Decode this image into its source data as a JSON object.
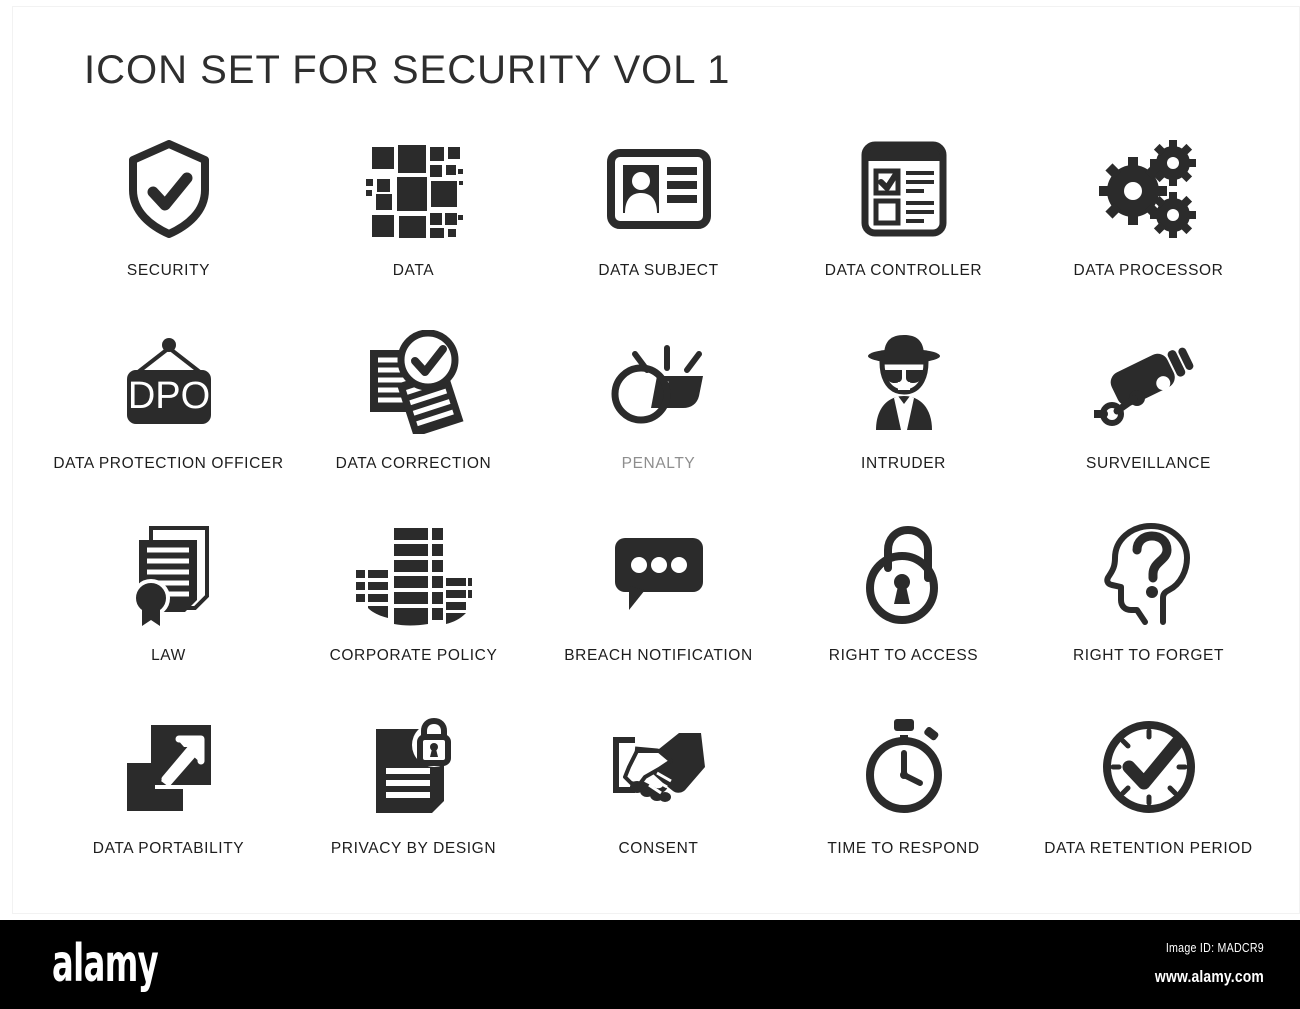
{
  "page": {
    "title": "ICON SET FOR SECURITY VOL 1",
    "background": "#ffffff",
    "icon_color": "#2b2b2b",
    "caption_color": "#1d1d1d"
  },
  "icons": [
    {
      "id": "security",
      "label": "SECURITY",
      "icon": "shield-check-icon",
      "row": 1,
      "col": 1
    },
    {
      "id": "data",
      "label": "DATA",
      "icon": "data-mosaic-squares-icon",
      "row": 1,
      "col": 2
    },
    {
      "id": "data-subject",
      "label": "DATA SUBJECT",
      "icon": "id-card-person-icon",
      "row": 1,
      "col": 3
    },
    {
      "id": "data-controller",
      "label": "DATA CONTROLLER",
      "icon": "checklist-clipboard-icon",
      "row": 1,
      "col": 4
    },
    {
      "id": "data-processor",
      "label": "DATA PROCESSOR",
      "icon": "gears-icon",
      "row": 1,
      "col": 5
    },
    {
      "id": "data-protection-officer",
      "label": "DATA PROTECTION OFFICER",
      "icon": "hanging-sign-dpo-icon",
      "row": 2,
      "col": 1,
      "sign_text": "DPO"
    },
    {
      "id": "data-correction",
      "label": "DATA CORRECTION",
      "icon": "documents-check-icon",
      "row": 2,
      "col": 2
    },
    {
      "id": "penalty",
      "label": "PENALTY",
      "icon": "whistle-icon",
      "row": 2,
      "col": 3,
      "label_faded": true
    },
    {
      "id": "intruder",
      "label": "INTRUDER",
      "icon": "spy-person-hat-icon",
      "row": 2,
      "col": 4
    },
    {
      "id": "surveillance",
      "label": "SURVEILLANCE",
      "icon": "cctv-camera-icon",
      "row": 2,
      "col": 5
    },
    {
      "id": "law",
      "label": "LAW",
      "icon": "certificate-seal-icon",
      "row": 3,
      "col": 1
    },
    {
      "id": "corporate-policy",
      "label": "CORPORATE POLICY",
      "icon": "office-building-icon",
      "row": 3,
      "col": 2
    },
    {
      "id": "breach-notification",
      "label": "BREACH NOTIFICATION",
      "icon": "speech-bubble-dots-icon",
      "row": 3,
      "col": 3
    },
    {
      "id": "right-to-access",
      "label": "RIGHT TO ACCESS",
      "icon": "open-padlock-icon",
      "row": 3,
      "col": 4
    },
    {
      "id": "right-to-forget",
      "label": "RIGHT TO FORGET",
      "icon": "head-question-mark-icon",
      "row": 3,
      "col": 5
    },
    {
      "id": "data-portability",
      "label": "DATA PORTABILITY",
      "icon": "export-arrow-square-icon",
      "row": 4,
      "col": 1
    },
    {
      "id": "privacy-by-design",
      "label": "PRIVACY BY DESIGN",
      "icon": "document-lock-icon",
      "row": 4,
      "col": 2
    },
    {
      "id": "consent",
      "label": "CONSENT",
      "icon": "handshake-icon",
      "row": 4,
      "col": 3
    },
    {
      "id": "time-to-respond",
      "label": "TIME TO RESPOND",
      "icon": "stopwatch-icon",
      "row": 4,
      "col": 4
    },
    {
      "id": "data-retention-period",
      "label": "DATA RETENTION PERIOD",
      "icon": "clock-check-icon",
      "row": 4,
      "col": 5
    }
  ],
  "watermark": {
    "logo": "alamy",
    "image_id": "Image ID: MADCR9",
    "url": "www.alamy.com",
    "bar_color": "#000000",
    "text_color": "#ffffff"
  }
}
